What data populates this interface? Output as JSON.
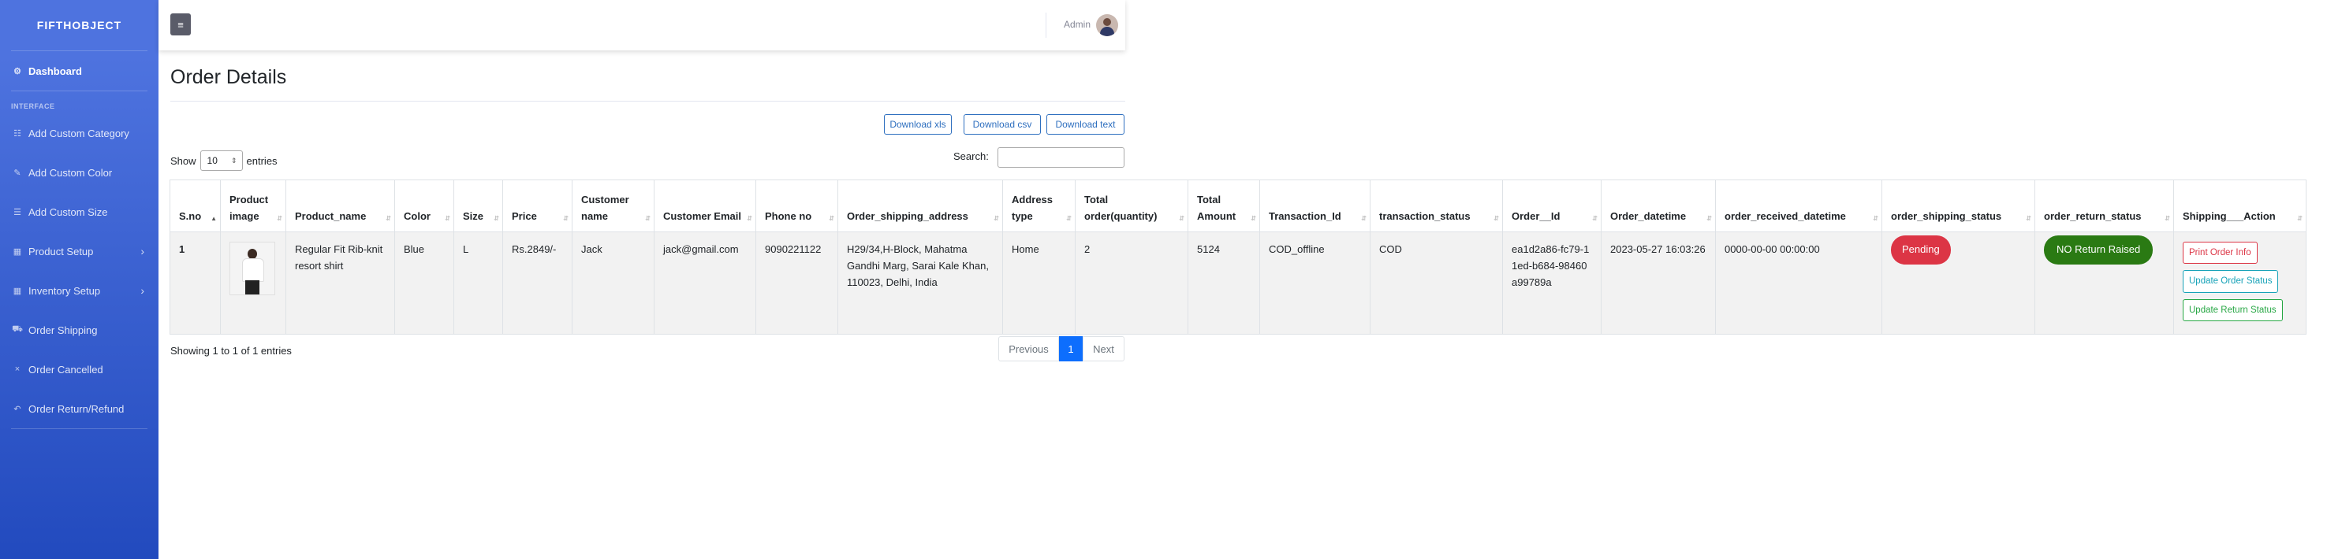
{
  "sidebar": {
    "brand": "FIFTHOBJECT",
    "dashboard": "Dashboard",
    "heading": "INTERFACE",
    "items": [
      {
        "label": "Add Custom Category",
        "icon": "sitemap-icon",
        "chevron": false
      },
      {
        "label": "Add Custom Color",
        "icon": "pen-icon",
        "chevron": false
      },
      {
        "label": "Add Custom Size",
        "icon": "list-icon",
        "chevron": false
      },
      {
        "label": "Product Setup",
        "icon": "table-icon",
        "chevron": true
      },
      {
        "label": "Inventory Setup",
        "icon": "table-icon",
        "chevron": true
      },
      {
        "label": "Order Shipping",
        "icon": "truck-icon",
        "chevron": false
      },
      {
        "label": "Order Cancelled",
        "icon": "times-icon",
        "chevron": false
      },
      {
        "label": "Order Return/Refund",
        "icon": "undo-icon",
        "chevron": false
      }
    ]
  },
  "topbar": {
    "user": "Admin"
  },
  "page": {
    "title": "Order Details",
    "download_xls": "Download xls",
    "download_csv": "Download csv",
    "download_text": "Download text",
    "show_label": "Show",
    "entries_value": "10",
    "entries_label": "entries",
    "search_label": "Search:",
    "showing": "Showing 1 to 1 of 1 entries",
    "prev": "Previous",
    "page": "1",
    "next": "Next"
  },
  "table": {
    "headers": [
      "S.no",
      "Product image",
      "Product_name",
      "Color",
      "Size",
      "Price",
      "Customer name",
      "Customer Email",
      "Phone no",
      "Order_shipping_address",
      "Address type",
      "Total order(quantity)",
      "Total Amount",
      "Transaction_Id",
      "transaction_status",
      "Order__Id",
      "Order_datetime",
      "order_received_datetime",
      "order_shipping_status",
      "order_return_status",
      "Shipping___Action"
    ],
    "row": {
      "sno": "1",
      "product_name": "Regular Fit Rib-knit resort shirt",
      "color": "Blue",
      "size": "L",
      "price": "Rs.2849/-",
      "customer_name": "Jack",
      "customer_email": "jack@gmail.com",
      "phone": "9090221122",
      "address": "H29/34,H-Block, Mahatma Gandhi Marg, Sarai Kale Khan, 110023, Delhi, India",
      "address_type": "Home",
      "quantity": "2",
      "amount": "5124",
      "transaction_id": "COD_offline",
      "transaction_status": "COD",
      "order_id": "ea1d2a86-fc79-11ed-b684-98460a99789a",
      "order_datetime": "2023-05-27 16:03:26",
      "received_datetime": "0000-00-00 00:00:00",
      "shipping_status": "Pending",
      "return_status": "NO Return Raised",
      "action_print": "Print Order Info",
      "action_update_order": "Update Order Status",
      "action_update_return": "Update Return Status"
    }
  }
}
